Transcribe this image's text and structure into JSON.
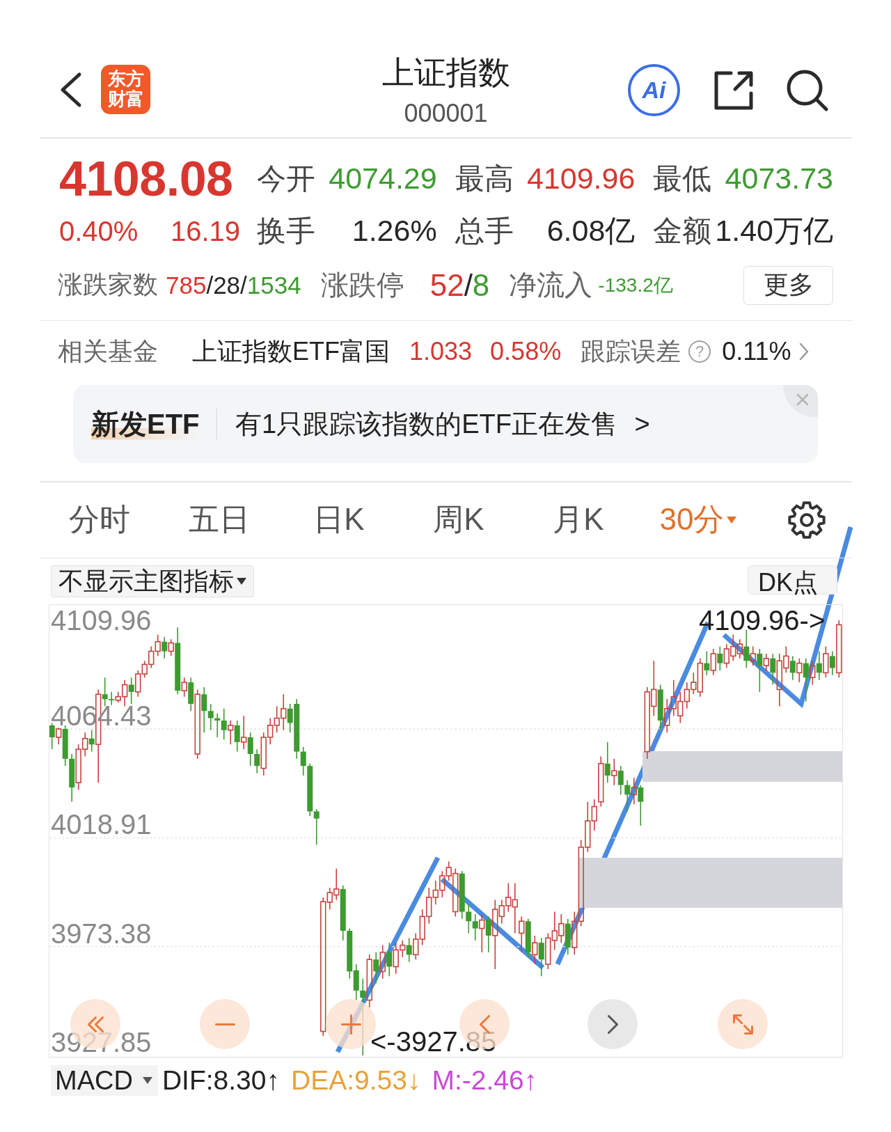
{
  "header": {
    "logo": "东方财富",
    "title": "上证指数",
    "code": "000001",
    "ai_label": "Ai"
  },
  "quote": {
    "price": "4108.08",
    "change_pct": "0.40%",
    "change": "16.19",
    "color": "#d7372f",
    "stats": [
      {
        "label": "今开",
        "value": "4074.29",
        "color": "#3d9b30"
      },
      {
        "label": "最高",
        "value": "4109.96",
        "color": "#d7372f"
      },
      {
        "label": "最低",
        "value": "4073.73",
        "color": "#3d9b30"
      },
      {
        "label": "换手",
        "value": "1.26%",
        "color": "#262626"
      },
      {
        "label": "总手",
        "value": "6.08亿",
        "color": "#262626"
      },
      {
        "label": "金额",
        "value": "1.40万亿",
        "color": "#262626"
      }
    ]
  },
  "market_breadth": {
    "items": [
      {
        "label": "涨跌家数",
        "parts": [
          {
            "text": "785",
            "color": "#d7372f"
          },
          {
            "text": "/28/",
            "color": "#262626"
          },
          {
            "text": "1534",
            "color": "#3d9b30"
          }
        ]
      },
      {
        "label": "涨跌停",
        "parts": [
          {
            "text": "52",
            "color": "#d7372f"
          },
          {
            "text": "/",
            "color": "#262626"
          },
          {
            "text": "8",
            "color": "#3d9b30"
          }
        ]
      },
      {
        "label": "净流入",
        "parts": [
          {
            "text": "-133.2亿",
            "color": "#3d9b30"
          }
        ]
      }
    ],
    "more_button": "更多"
  },
  "related_fund": {
    "label": "相关基金",
    "name": "上证指数ETF富国",
    "price": "1.033",
    "change_pct": "0.58%",
    "color": "#d7372f",
    "tracking_label": "跟踪误差",
    "help_mark": "?",
    "tracking_error": "0.11%"
  },
  "banner": {
    "tag": "新发ETF",
    "message": "有1只跟踪该指数的ETF正在发售 >"
  },
  "period_tabs": [
    {
      "label": "分时",
      "selected": false,
      "kind": "tab"
    },
    {
      "label": "五日",
      "selected": false,
      "kind": "tab"
    },
    {
      "label": "日K",
      "selected": false,
      "kind": "tab"
    },
    {
      "label": "周K",
      "selected": false,
      "kind": "tab"
    },
    {
      "label": "月K",
      "selected": false,
      "kind": "tab"
    },
    {
      "label": "30分",
      "selected": true,
      "kind": "menu"
    }
  ],
  "chart": {
    "indicator_menu": "不显示主图指标",
    "dk_button": "DK点",
    "high_marker": "4109.96->",
    "low_marker": "<-3927.85",
    "chart_data": {
      "type": "candlestick",
      "ylim": [
        3927.85,
        4116.37
      ],
      "yticks": [
        4109.96,
        4064.43,
        4018.91,
        3973.38,
        3927.85
      ],
      "grid": true,
      "ohlc": [
        [
          4066.0,
          4067.0,
          4056.0,
          4061.0
        ],
        [
          4061.0,
          4065.0,
          4058.0,
          4064.5
        ],
        [
          4064.5,
          4066.0,
          4049.0,
          4052.0
        ],
        [
          4052.0,
          4054.0,
          4034.0,
          4040.0
        ],
        [
          4042.0,
          4058.0,
          4039.0,
          4056.0
        ],
        [
          4056.0,
          4063.0,
          4053.0,
          4060.5
        ],
        [
          4060.5,
          4064.0,
          4055.0,
          4058.0
        ],
        [
          4058.0,
          4081.0,
          4042.0,
          4079.0
        ],
        [
          4079.0,
          4086.0,
          4074.0,
          4077.0
        ],
        [
          4077.0,
          4080.0,
          4074.5,
          4076.5
        ],
        [
          4076.5,
          4080.0,
          4075.5,
          4078.0
        ],
        [
          4078.0,
          4085.0,
          4074.0,
          4083.0
        ],
        [
          4083.0,
          4086.0,
          4075.0,
          4080.0
        ],
        [
          4080.0,
          4089.0,
          4078.0,
          4087.5
        ],
        [
          4087.5,
          4093.0,
          4086.0,
          4091.5
        ],
        [
          4091.5,
          4099.0,
          4090.0,
          4097.0
        ],
        [
          4097.0,
          4104.0,
          4095.0,
          4101.0
        ],
        [
          4101.0,
          4103.0,
          4094.0,
          4097.0
        ],
        [
          4097.0,
          4102.0,
          4095.0,
          4100.5
        ],
        [
          4100.5,
          4107.0,
          4079.0,
          4080.5
        ],
        [
          4080.5,
          4086.0,
          4078.0,
          4084.0
        ],
        [
          4084.0,
          4086.0,
          4072.0,
          4075.0
        ],
        [
          4054.0,
          4081.0,
          4052.0,
          4079.0
        ],
        [
          4079.0,
          4082.0,
          4063.0,
          4072.0
        ],
        [
          4072.0,
          4075.0,
          4064.0,
          4069.0
        ],
        [
          4069.0,
          4071.0,
          4061.0,
          4068.0
        ],
        [
          4068.0,
          4073.0,
          4060.0,
          4064.0
        ],
        [
          4064.0,
          4068.0,
          4058.0,
          4066.0
        ],
        [
          4066.0,
          4068.0,
          4055.0,
          4059.0
        ],
        [
          4059.0,
          4070.0,
          4056.0,
          4061.0
        ],
        [
          4061.0,
          4063.0,
          4049.0,
          4054.0
        ],
        [
          4054.0,
          4056.0,
          4046.0,
          4049.0
        ],
        [
          4048.0,
          4063.0,
          4045.0,
          4061.0
        ],
        [
          4061.0,
          4069.0,
          4058.0,
          4066.0
        ],
        [
          4066.0,
          4074.0,
          4063.0,
          4069.0
        ],
        [
          4069.0,
          4079.0,
          4064.0,
          4073.0
        ],
        [
          4073.0,
          4075.0,
          4063.0,
          4067.0
        ],
        [
          4075.0,
          4077.0,
          4052.0,
          4055.0
        ],
        [
          4055.0,
          4057.0,
          4045.0,
          4049.0
        ],
        [
          4049.0,
          4050.0,
          4028.0,
          4030.0
        ],
        [
          4030.0,
          4031.0,
          4016.0,
          4027.0
        ],
        [
          3937.9,
          3994.0,
          3936.0,
          3992.2
        ],
        [
          3992.0,
          3998.0,
          3989.0,
          3996.0
        ],
        [
          3995.0,
          4006.0,
          3993.0,
          3997.5
        ],
        [
          3997.5,
          3999.0,
          3976.0,
          3980.0
        ],
        [
          3980.0,
          3981.0,
          3960.0,
          3963.0
        ],
        [
          3963.5,
          3966.0,
          3951.0,
          3955.0
        ],
        [
          3955.0,
          3960.0,
          3927.85,
          3952.0
        ],
        [
          3951.0,
          3970.0,
          3948.0,
          3968.0
        ],
        [
          3968.0,
          3971.0,
          3958.0,
          3963.0
        ],
        [
          3963.0,
          3974.0,
          3960.0,
          3971.0
        ],
        [
          3971.0,
          3975.0,
          3961.0,
          3965.0
        ],
        [
          3965.0,
          3975.0,
          3962.0,
          3972.0
        ],
        [
          3972.0,
          3976.0,
          3969.0,
          3974.0
        ],
        [
          3974.0,
          3977.0,
          3967.0,
          3970.0
        ],
        [
          3970.0,
          3979.0,
          3968.0,
          3976.5
        ],
        [
          3976.5,
          3989.0,
          3974.0,
          3986.0
        ],
        [
          3986.0,
          3998.0,
          3983.0,
          3994.0
        ],
        [
          3994.0,
          4001.0,
          3991.0,
          3997.0
        ],
        [
          3997.0,
          4005.0,
          3994.0,
          4003.0
        ],
        [
          4003.0,
          4009.0,
          4001.0,
          4006.5
        ],
        [
          3988.0,
          4006.0,
          3986.0,
          4004.0
        ],
        [
          4004.0,
          4005.0,
          3985.0,
          3988.0
        ],
        [
          3988.0,
          3991.0,
          3979.0,
          3984.0
        ],
        [
          3984.0,
          3987.0,
          3976.0,
          3981.0
        ],
        [
          3981.0,
          3987.0,
          3971.0,
          3984.5
        ],
        [
          3984.5,
          3986.0,
          3971.0,
          3978.0
        ],
        [
          3978.0,
          3993.0,
          3964.0,
          3989.0
        ],
        [
          3986.0,
          3993.0,
          3983.0,
          3990.5
        ],
        [
          3990.5,
          4000.0,
          3988.0,
          3994.0
        ],
        [
          3990.0,
          4000.0,
          3979.0,
          3993.0
        ],
        [
          3979.0,
          3986.0,
          3971.0,
          3984.0
        ],
        [
          3984.0,
          3985.0,
          3969.0,
          3971.0
        ],
        [
          3970.0,
          3978.0,
          3966.0,
          3975.0
        ],
        [
          3975.0,
          3977.0,
          3961.0,
          3968.0
        ],
        [
          3966.0,
          3979.0,
          3964.0,
          3977.0
        ],
        [
          3976.0,
          3988.0,
          3972.0,
          3980.0
        ],
        [
          3978.0,
          3987.0,
          3975.0,
          3983.0
        ],
        [
          3983.0,
          3985.0,
          3970.0,
          3973.0
        ],
        [
          3973.0,
          3988.0,
          3970.0,
          3984.0
        ],
        [
          3984.0,
          4018.0,
          3982.0,
          4015.0
        ],
        [
          4015.0,
          4034.0,
          4013.0,
          4026.0
        ],
        [
          4026.0,
          4035.0,
          4022.0,
          4032.0
        ],
        [
          4034.0,
          4053.0,
          4032.0,
          4050.0
        ],
        [
          4050.0,
          4059.0,
          4042.0,
          4045.0
        ],
        [
          4045.0,
          4052.0,
          4041.0,
          4047.0
        ],
        [
          4047.0,
          4049.0,
          4037.0,
          4041.0
        ],
        [
          4041.0,
          4043.0,
          4030.0,
          4037.0
        ],
        [
          4037.0,
          4044.0,
          4033.0,
          4040.0
        ],
        [
          4040.0,
          4041.0,
          4024.0,
          4034.0
        ],
        [
          4055.0,
          4082.0,
          4052.0,
          4080.0
        ],
        [
          4074.0,
          4093.0,
          4070.0,
          4081.0
        ],
        [
          4081.0,
          4083.0,
          4064.0,
          4068.0
        ],
        [
          4066.0,
          4077.0,
          4063.0,
          4073.0
        ],
        [
          4073.0,
          4085.0,
          4070.0,
          4078.0
        ],
        [
          4070.0,
          4080.0,
          4067.0,
          4076.0
        ],
        [
          4076.0,
          4084.0,
          4073.0,
          4081.0
        ],
        [
          4081.0,
          4088.0,
          4079.0,
          4084.0
        ],
        [
          4080.0,
          4094.0,
          4078.0,
          4092.0
        ],
        [
          4092.0,
          4097.0,
          4087.0,
          4089.0
        ],
        [
          4089.0,
          4098.0,
          4087.0,
          4096.0
        ],
        [
          4096.0,
          4099.0,
          4089.0,
          4092.0
        ],
        [
          4092.0,
          4100.0,
          4090.0,
          4098.0
        ],
        [
          4095.0,
          4104.0,
          4093.0,
          4099.0
        ],
        [
          4096.0,
          4102.0,
          4094.0,
          4100.0
        ],
        [
          4099.0,
          4106.0,
          4090.0,
          4093.0
        ],
        [
          4093.0,
          4099.0,
          4091.0,
          4096.0
        ],
        [
          4096.0,
          4098.0,
          4080.0,
          4091.0
        ],
        [
          4091.0,
          4096.0,
          4089.0,
          4094.0
        ],
        [
          4094.0,
          4096.0,
          4083.0,
          4088.0
        ],
        [
          4081.0,
          4096.0,
          4074.0,
          4093.0
        ],
        [
          4090.0,
          4099.0,
          4088.0,
          4095.0
        ],
        [
          4093.0,
          4095.0,
          4085.0,
          4088.0
        ],
        [
          4088.0,
          4094.0,
          4084.0,
          4092.0
        ],
        [
          4092.0,
          4094.0,
          4076.0,
          4086.0
        ],
        [
          4086.0,
          4093.0,
          4083.0,
          4091.0
        ],
        [
          4092.0,
          4097.0,
          4085.0,
          4088.0
        ],
        [
          4088.0,
          4099.0,
          4086.0,
          4096.0
        ],
        [
          4095.0,
          4097.0,
          4087.0,
          4090.0
        ],
        [
          4088.0,
          4109.96,
          4086.0,
          4108.08
        ]
      ]
    }
  },
  "macd": {
    "menu": "MACD",
    "values": [
      {
        "text": "DIF:8.30↑",
        "color": "#222222"
      },
      {
        "text": "DEA:9.53↓",
        "color": "#e8a23a"
      },
      {
        "text": "M:-2.46↑",
        "color": "#c64bd5"
      }
    ]
  }
}
